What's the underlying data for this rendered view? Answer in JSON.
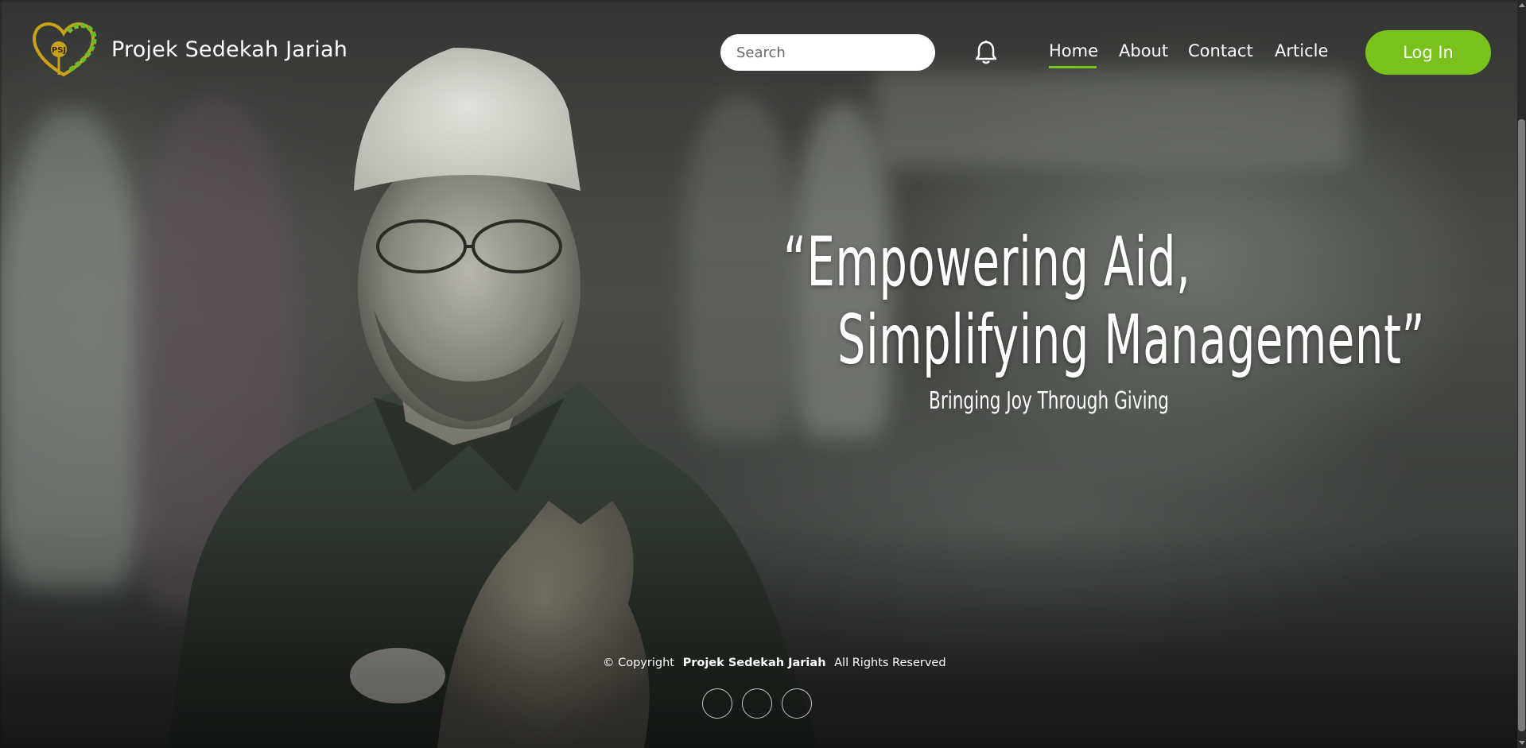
{
  "brand": {
    "name": "Projek Sedekah Jariah",
    "logo_icon": "psj-heart-logo-icon",
    "logo_text": "PSJ"
  },
  "search": {
    "placeholder": "Search",
    "value": ""
  },
  "notifications": {
    "icon": "bell-icon"
  },
  "nav": {
    "items": [
      {
        "label": "Home",
        "active": true
      },
      {
        "label": "About",
        "active": false
      },
      {
        "label": "Contact",
        "active": false
      },
      {
        "label": "Article",
        "active": false
      }
    ],
    "login_label": "Log In"
  },
  "hero": {
    "quote_line1": "“Empowering Aid,",
    "quote_line2": "Simplifying Management”",
    "tagline": "Bringing Joy Through Giving"
  },
  "footer": {
    "copyright_prefix": "© Copyright",
    "copyright_name": "Projek Sedekah Jariah",
    "copyright_suffix": "All Rights Reserved",
    "social_icons": [
      "social-icon-1",
      "social-icon-2",
      "social-icon-3"
    ]
  },
  "colors": {
    "accent": "#79c11b",
    "text": "#ffffff",
    "search_bg": "#ffffff"
  }
}
